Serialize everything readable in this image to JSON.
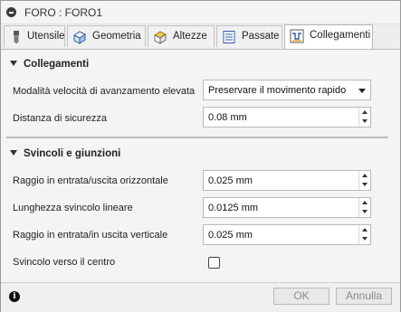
{
  "window": {
    "title": "FORO : FORO1"
  },
  "tabs": [
    {
      "label": "Utensile",
      "icon": "tool-icon"
    },
    {
      "label": "Geometria",
      "icon": "geometry-icon"
    },
    {
      "label": "Altezze",
      "icon": "heights-icon"
    },
    {
      "label": "Passate",
      "icon": "passes-icon"
    },
    {
      "label": "Collegamenti",
      "icon": "linking-icon",
      "active": true
    }
  ],
  "sections": {
    "collegamenti": {
      "title": "Collegamenti",
      "rapid_label": "Modalità velocità di avanzamento elevata",
      "rapid_value": "Preservare il movimento rapido",
      "safe_distance_label": "Distanza di sicurezza",
      "safe_distance_value": "0.08 mm"
    },
    "svincoli": {
      "title": "Svincoli e giunzioni",
      "horizontal_radius_label": "Raggio in entrata/uscita orizzontale",
      "horizontal_radius_value": "0.025 mm",
      "linear_length_label": "Lunghezza svincolo lineare",
      "linear_length_value": "0.0125 mm",
      "vertical_radius_label": "Raggio in entrata/in uscita verticale",
      "vertical_radius_value": "0.025 mm",
      "center_label": "Svincolo verso il centro",
      "center_checked": false
    }
  },
  "footer": {
    "info_glyph": "i",
    "ok_label": "OK",
    "cancel_label": "Annulla"
  }
}
